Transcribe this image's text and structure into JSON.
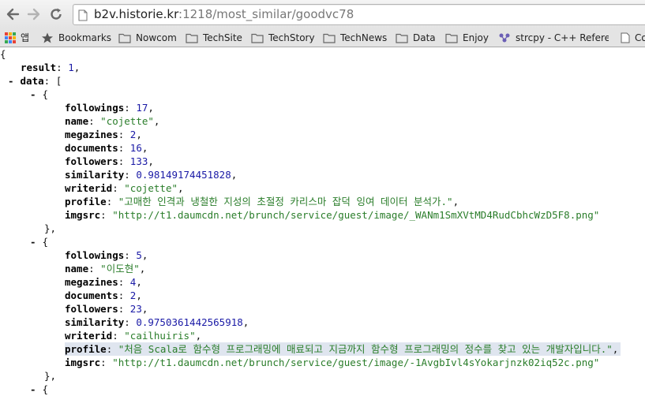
{
  "browser": {
    "url_host": "b2v.historie.kr",
    "url_rest": ":1218/most_similar/goodvc78",
    "bookmarks": [
      {
        "label": "앱",
        "icon": "apps-grid-icon"
      },
      {
        "label": "Bookmarks",
        "icon": "star-icon"
      },
      {
        "label": "Nowcom",
        "icon": "folder-icon"
      },
      {
        "label": "TechSite",
        "icon": "folder-icon"
      },
      {
        "label": "TechStory",
        "icon": "folder-icon"
      },
      {
        "label": "TechNews",
        "icon": "folder-icon"
      },
      {
        "label": "Data",
        "icon": "folder-icon"
      },
      {
        "label": "Enjoy",
        "icon": "folder-icon"
      },
      {
        "label": "strcpy - C++ Reference",
        "icon": "cplusplus-icon"
      },
      {
        "label": "Co",
        "icon": "page-icon"
      }
    ]
  },
  "json_view": {
    "open_brace": "{",
    "result_key": "result",
    "result_value": "1",
    "data_key": "data",
    "open_bracket": "[",
    "toggle_symbol": "-",
    "items": [
      {
        "followings": "17",
        "name": "\"cojette\"",
        "megazines": "2",
        "documents": "16",
        "followers": "133",
        "similarity": "0.98149174451828",
        "writerid": "\"cojette\"",
        "profile": "\"고매한 인격과 냉철한 지성의 초절정 카리스마 잡덕 잉여 데이터 분석가.\"",
        "imgsrc": "\"http://t1.daumcdn.net/brunch/service/guest/image/_WANm1SmXVtMD4RudCbhcWzD5F8.png\""
      },
      {
        "followings": "5",
        "name": "\"이도현\"",
        "megazines": "4",
        "documents": "2",
        "followers": "23",
        "similarity": "0.9750361442565918",
        "writerid": "\"cailhuiris\"",
        "profile": "\"처음 Scala로 함수형 프로그래밍에 매료되고 지금까지 함수형 프로그래밍의 정수를 찾고 있는 개발자입니다.\"",
        "imgsrc": "\"http://t1.daumcdn.net/brunch/service/guest/image/-1AvgbIvl4sYokarjnzk02iq52c.png\""
      }
    ],
    "field_keys": [
      "followings",
      "name",
      "megazines",
      "documents",
      "followers",
      "similarity",
      "writerid",
      "profile",
      "imgsrc"
    ],
    "field_types": [
      "num",
      "str",
      "num",
      "num",
      "num",
      "num",
      "str",
      "str",
      "str"
    ],
    "close_item": "},",
    "open_item": "{",
    "trailing_brace": "{"
  }
}
